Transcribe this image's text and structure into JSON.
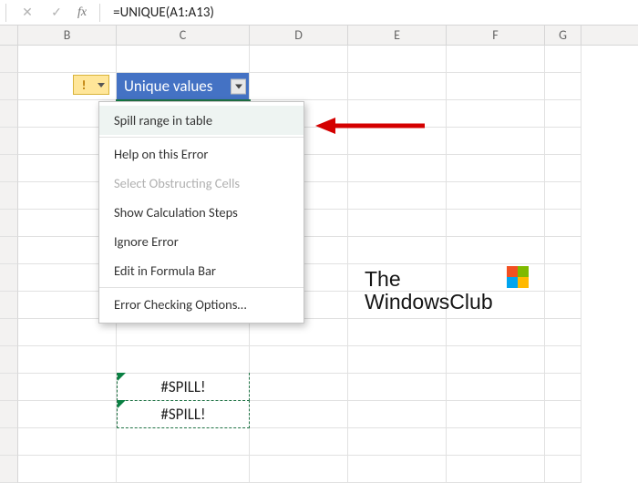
{
  "formula_bar": {
    "cancel": "✕",
    "confirm": "✓",
    "fx": "fx",
    "value": "=UNIQUE(A1:A13)"
  },
  "columns": {
    "B": "B",
    "C": "C",
    "D": "D",
    "E": "E",
    "F": "F",
    "G": "G"
  },
  "table": {
    "header": "Unique values",
    "error_value": "#SPILL!"
  },
  "error_indicator": {
    "icon": "!"
  },
  "context_menu": {
    "items": [
      {
        "label": "Spill range in table",
        "highlight": true
      },
      {
        "label": "Help on this Error"
      },
      {
        "label": "Select Obstructing Cells",
        "disabled": true,
        "ul_char": "S"
      },
      {
        "label": "Show Calculation Steps"
      },
      {
        "label": "Ignore Error",
        "ul_char": "I"
      },
      {
        "label": "Edit in Formula Bar",
        "ul_char": "F"
      },
      {
        "label": "Error Checking Options…",
        "ul_char": "O"
      }
    ]
  },
  "watermark": {
    "line1": "The",
    "line2": "WindowsClub"
  },
  "spill_below": [
    "#SPILL!",
    "#SPILL!"
  ]
}
